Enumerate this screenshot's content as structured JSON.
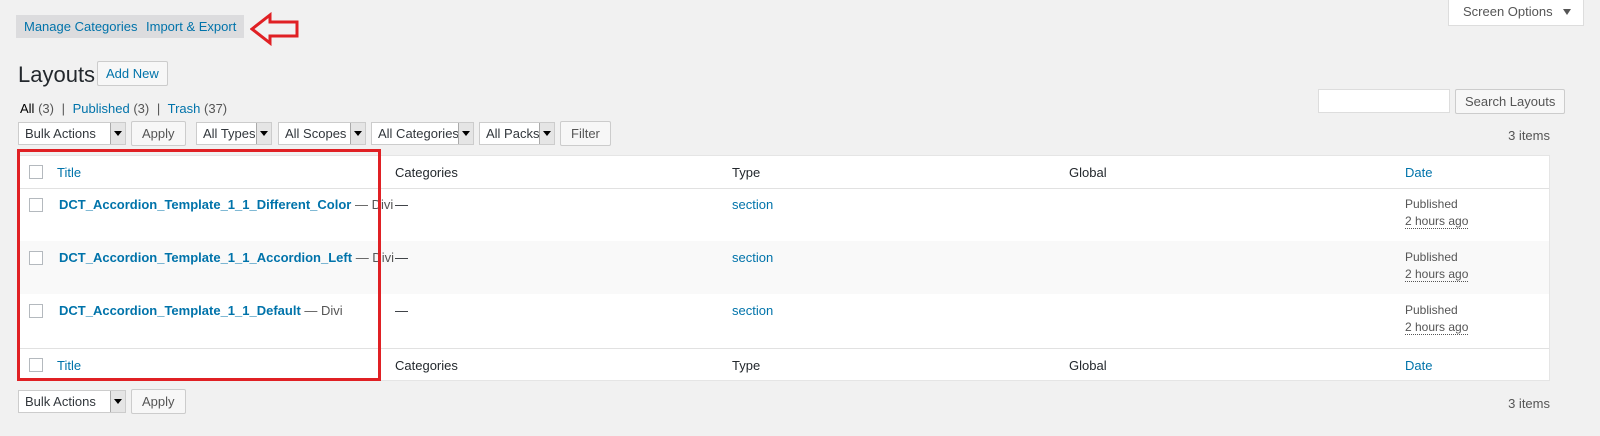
{
  "tabs": {
    "manage": "Manage Categories",
    "import_export": "Import & Export"
  },
  "screen_options": "Screen Options",
  "page": {
    "title": "Layouts",
    "add_new": "Add New"
  },
  "filters_links": {
    "all": "All",
    "all_count": "(3)",
    "published": "Published",
    "published_count": "(3)",
    "trash": "Trash",
    "trash_count": "(37)",
    "sep": "|"
  },
  "search": {
    "button": "Search Layouts"
  },
  "toolbar": {
    "bulk_actions": "Bulk Actions",
    "apply": "Apply",
    "all_types": "All Types",
    "all_scopes": "All Scopes",
    "all_categories": "All Categories",
    "all_packs": "All Packs",
    "filter": "Filter",
    "items": "3 items"
  },
  "columns": {
    "title": "Title",
    "categories": "Categories",
    "type": "Type",
    "global": "Global",
    "date": "Date"
  },
  "rows": [
    {
      "title": "DCT_Accordion_Template_1_1_Different_Color",
      "suffix": "— Divi",
      "categories": "—",
      "type": "section",
      "status": "Published",
      "ago": "2 hours ago"
    },
    {
      "title": "DCT_Accordion_Template_1_1_Accordion_Left",
      "suffix": "— Divi",
      "categories": "—",
      "type": "section",
      "status": "Published",
      "ago": "2 hours ago"
    },
    {
      "title": "DCT_Accordion_Template_1_1_Default",
      "suffix": "— Divi",
      "categories": "—",
      "type": "section",
      "status": "Published",
      "ago": "2 hours ago"
    }
  ],
  "colors": {
    "annotation_red": "#e02024",
    "link_blue": "#0073aa"
  }
}
